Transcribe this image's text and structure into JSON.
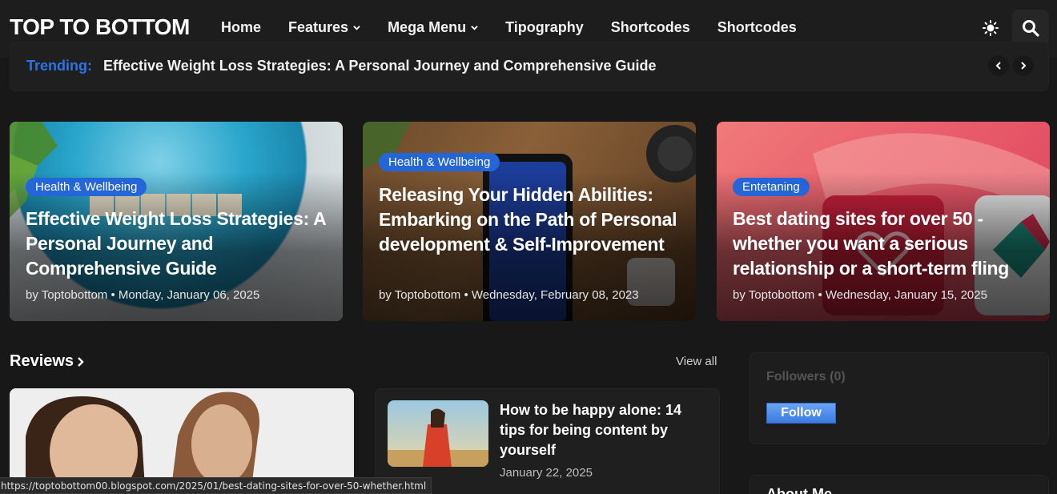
{
  "header": {
    "logo": "TOP TO BOTTOM",
    "nav": [
      {
        "label": "Home"
      },
      {
        "label": "Features"
      },
      {
        "label": "Mega Menu"
      },
      {
        "label": "Tipography"
      },
      {
        "label": "Shortcodes"
      },
      {
        "label": "Shortcodes"
      }
    ],
    "theme_icon": "sun-icon",
    "search_icon": "search-icon"
  },
  "trending": {
    "label": "Trending:",
    "text": "Effective Weight Loss Strategies: A Personal Journey and Comprehensive Guide"
  },
  "featured": [
    {
      "badge": "Health & Wellbeing",
      "title": "Effective Weight Loss Strategies: A Personal Journey and Comprehensive Guide",
      "meta": "by Toptobottom • Monday, January 06, 2025"
    },
    {
      "badge": "Health & Wellbeing",
      "title": "Releasing Your Hidden Abilities: Embarking on the Path of Personal development & Self-Improvement",
      "meta": "by Toptobottom • Wednesday, February 08, 2023"
    },
    {
      "badge": "Entetaning",
      "title": "Best dating sites for over 50 - whether you want a serious relationship or a short-term fling",
      "meta": "by Toptobottom • Wednesday, January 15, 2025"
    }
  ],
  "reviews": {
    "heading": "Reviews",
    "view_all": "View all",
    "post": {
      "title": "How to be happy alone: 14 tips for being content by yourself",
      "date": "January 22, 2025"
    }
  },
  "sidebar": {
    "followers_title": "Followers (0)",
    "follow_button": "Follow",
    "about_title": "About Me"
  },
  "status_url": "https://toptobottom00.blogspot.com/2025/01/best-dating-sites-for-over-50-whether.html",
  "colors": {
    "accent": "#2d73e8",
    "badge": "#2466d8",
    "background": "#181818"
  }
}
